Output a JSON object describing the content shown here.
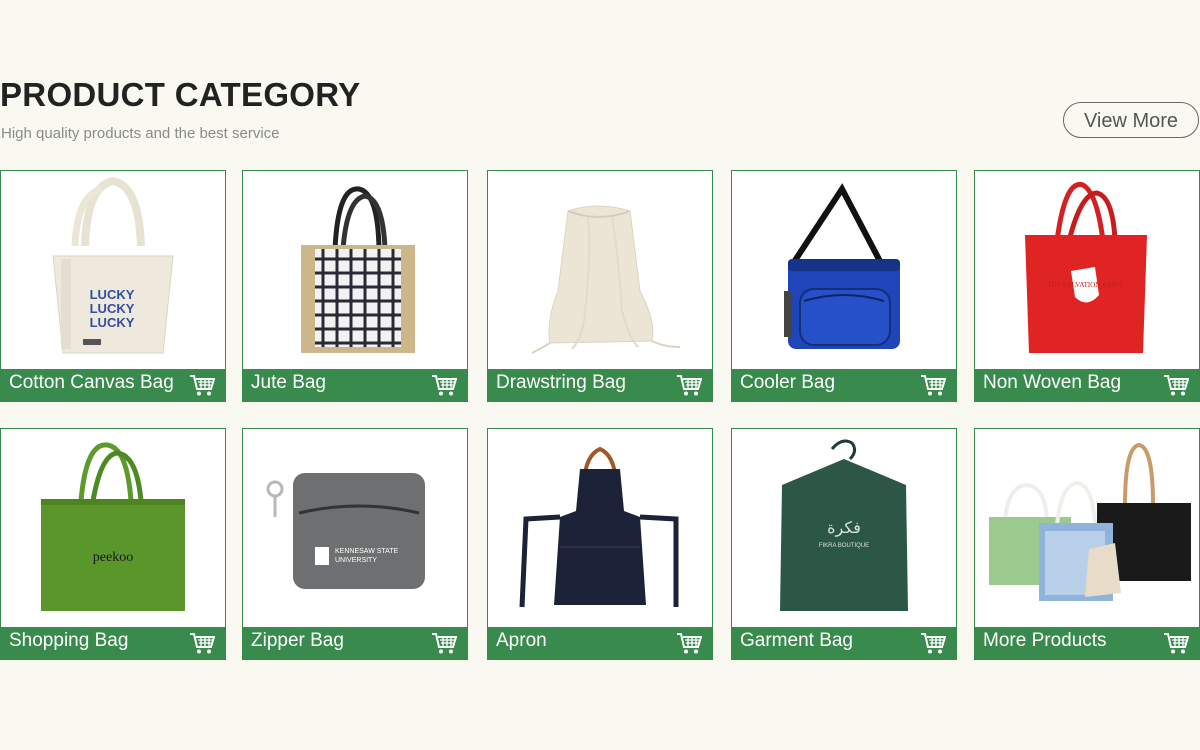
{
  "header": {
    "title": "PRODUCT CATEGORY",
    "subtitle": "High quality products and the best service",
    "view_more": "View More"
  },
  "products": [
    {
      "label": "Cotton Canvas Bag",
      "icon": "cart-icon",
      "print": "LUCKY\nLUCKY\nLUCKY"
    },
    {
      "label": "Jute Bag",
      "icon": "cart-icon"
    },
    {
      "label": "Drawstring Bag",
      "icon": "cart-icon"
    },
    {
      "label": "Cooler Bag",
      "icon": "cart-icon"
    },
    {
      "label": "Non Woven Bag",
      "icon": "cart-icon",
      "print": "THE SALVATION ARMY"
    },
    {
      "label": "Shopping Bag",
      "icon": "cart-icon",
      "print": "peekoo"
    },
    {
      "label": "Zipper Bag",
      "icon": "cart-icon",
      "print": "KENNESAW STATE UNIVERSITY"
    },
    {
      "label": "Apron",
      "icon": "cart-icon"
    },
    {
      "label": "Garment Bag",
      "icon": "cart-icon",
      "print": "FIKRA BOUTIQUE"
    },
    {
      "label": "More Products",
      "icon": "cart-icon"
    }
  ],
  "colors": {
    "background": "#f9f9f1",
    "accent_green": "#398a4d",
    "border_green": "#36894a"
  }
}
